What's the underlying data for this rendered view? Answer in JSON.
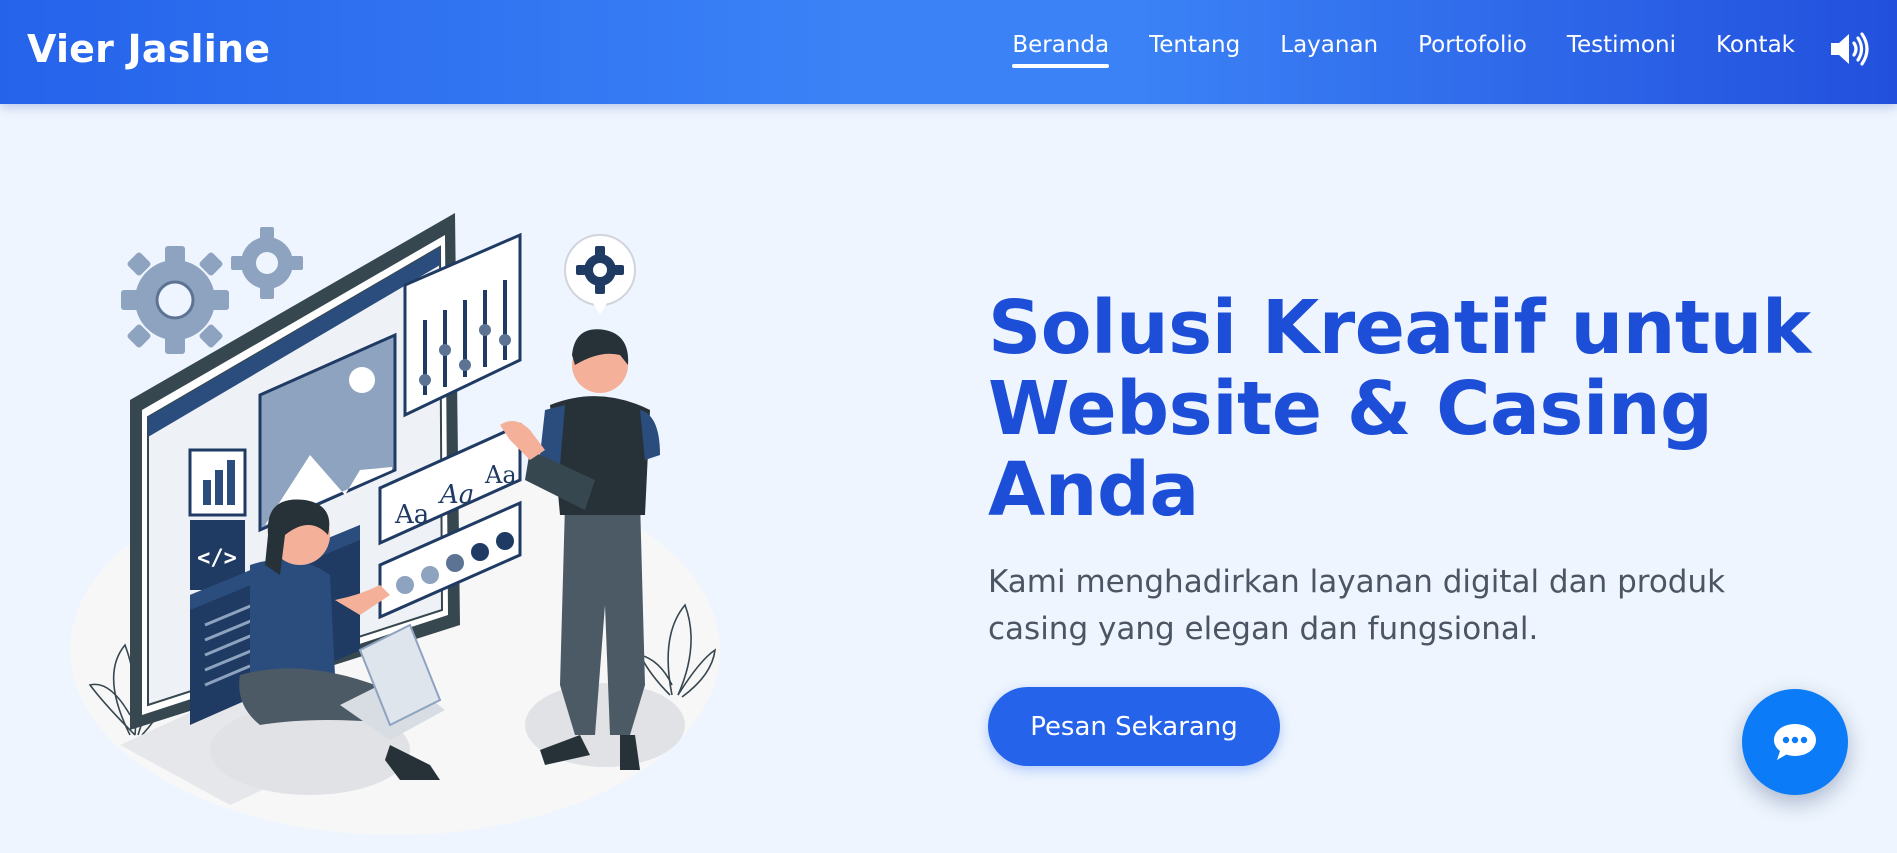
{
  "brand": {
    "name": "Vier Jasline"
  },
  "nav": {
    "items": [
      {
        "label": "Beranda",
        "active": true
      },
      {
        "label": "Tentang",
        "active": false
      },
      {
        "label": "Layanan",
        "active": false
      },
      {
        "label": "Portofolio",
        "active": false
      },
      {
        "label": "Testimoni",
        "active": false
      },
      {
        "label": "Kontak",
        "active": false
      }
    ],
    "sound_icon": "volume-icon"
  },
  "hero": {
    "title": "Solusi Kreatif untuk Website & Casing Anda",
    "subtitle": "Kami menghadirkan layanan digital dan produk casing yang elegan dan fungsional.",
    "cta_label": "Pesan Sekarang",
    "illustration_icons": [
      "gear-icon",
      "code-icon",
      "image-icon",
      "bar-chart-icon",
      "sliders-icon"
    ],
    "illustration_text": {
      "font_sample": "Aa"
    }
  },
  "chat": {
    "icon": "chat-icon"
  },
  "colors": {
    "nav_start": "#2563eb",
    "nav_mid": "#3b82f6",
    "background": "#eef5fe",
    "title": "#1d4ed8",
    "subtitle": "#4b5563",
    "button": "#2563eb",
    "chat": "#0b7bf7"
  }
}
